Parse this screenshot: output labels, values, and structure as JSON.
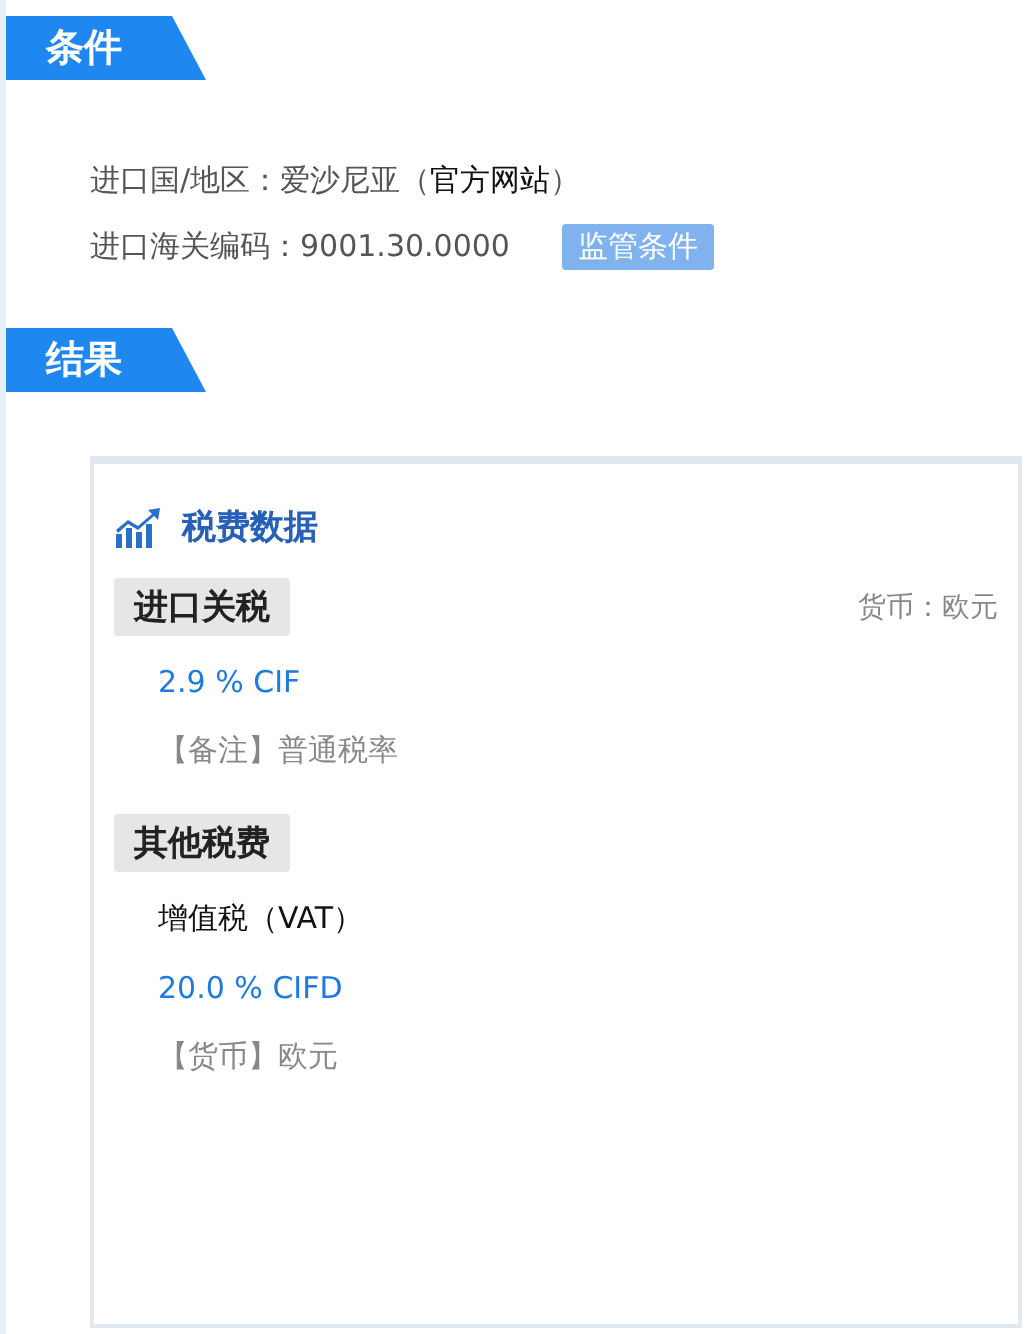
{
  "conditions": {
    "heading": "条件",
    "lines": [
      {
        "kind": "link-line",
        "label": "进口国/地区：",
        "value": "爱沙尼亚",
        "link_open": "（",
        "link": "官方网站",
        "link_close": "）"
      },
      {
        "kind": "button-line",
        "label": "进口海关编码：",
        "value": "9001.30.0000",
        "button": "监管条件"
      }
    ]
  },
  "results": {
    "heading": "结果",
    "card": {
      "title": "税费数据",
      "groups": [
        {
          "label": "进口关税",
          "currency": "货币：欧元",
          "entries": [
            {
              "kind": "rate",
              "text": "2.9 % CIF"
            },
            {
              "kind": "remark",
              "text": "【备注】普通税率"
            }
          ]
        },
        {
          "label": "其他税费",
          "entries": [
            {
              "kind": "name",
              "text": "增值税（VAT）"
            },
            {
              "kind": "rate",
              "text": "20.0 % CIFD"
            },
            {
              "kind": "remark",
              "text": "【货币】欧元"
            }
          ]
        }
      ]
    }
  }
}
